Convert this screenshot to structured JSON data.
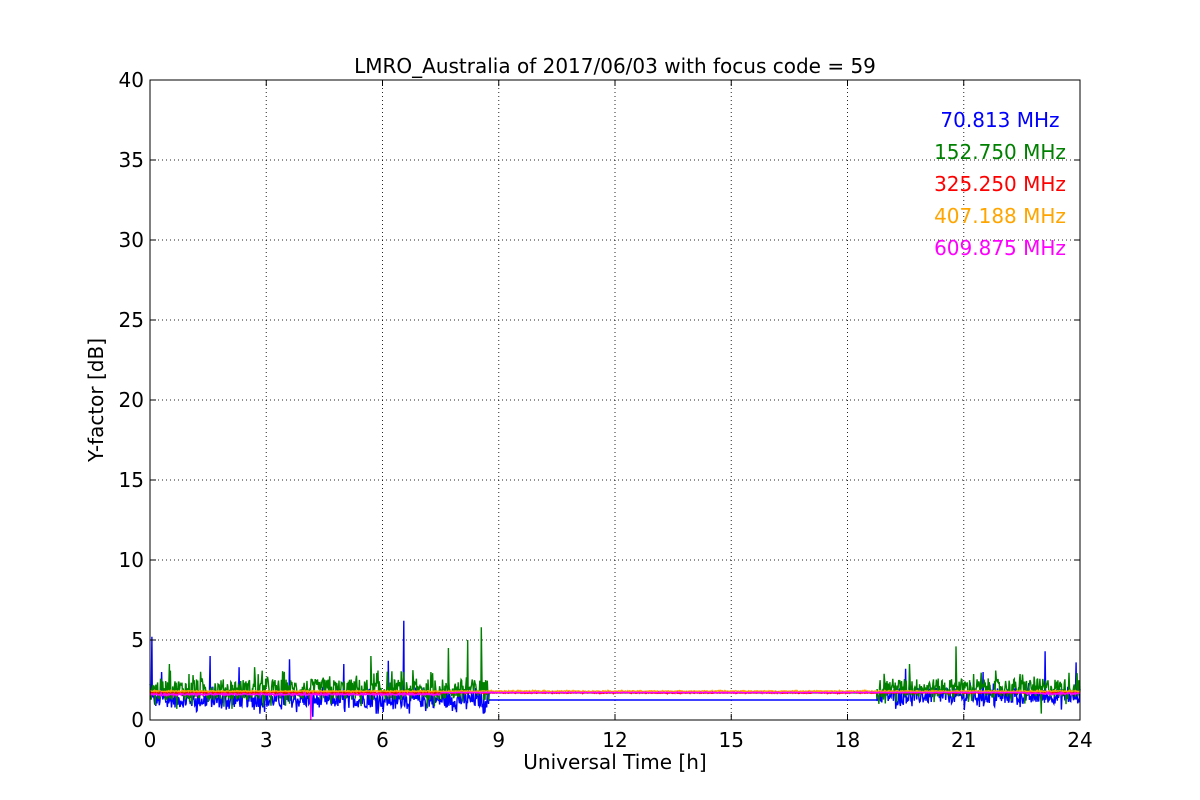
{
  "chart_data": {
    "type": "line",
    "title": "LMRO_Australia of 2017/06/03 with focus code = 59",
    "xlabel": "Universal Time [h]",
    "ylabel": "Y-factor [dB]",
    "xlim": [
      0,
      24
    ],
    "ylim": [
      0,
      40
    ],
    "xticks": [
      0,
      3,
      6,
      9,
      12,
      15,
      18,
      21,
      24
    ],
    "yticks": [
      0,
      5,
      10,
      15,
      20,
      25,
      30,
      35,
      40
    ],
    "grid": true,
    "legend_position": "top-right",
    "series": [
      {
        "name": "70.813 MHz",
        "color": "#0000ff",
        "segments": [
          {
            "x_range": [
              0,
              8.75
            ],
            "mean": 1.25,
            "noise": 0.8,
            "spikes": [
              [
                0.05,
                5.2
              ],
              [
                0.3,
                3.0
              ],
              [
                1.55,
                4.0
              ],
              [
                2.3,
                3.3
              ],
              [
                3.6,
                3.8
              ],
              [
                4.2,
                0.2
              ],
              [
                5.0,
                3.5
              ],
              [
                6.15,
                3.7
              ],
              [
                6.55,
                6.2
              ],
              [
                8.6,
                0.4
              ]
            ]
          },
          {
            "x_range": [
              8.75,
              18.75
            ],
            "mean": 1.25,
            "noise": 0,
            "spikes": []
          },
          {
            "x_range": [
              18.75,
              24
            ],
            "mean": 1.5,
            "noise": 0.8,
            "spikes": [
              [
                19.5,
                3.2
              ],
              [
                21.5,
                3.0
              ],
              [
                23.1,
                4.3
              ],
              [
                23.9,
                3.6
              ]
            ]
          }
        ]
      },
      {
        "name": "152.750 MHz",
        "color": "#008000",
        "segments": [
          {
            "x_range": [
              0,
              8.75
            ],
            "mean": 1.9,
            "noise": 1.1,
            "spikes": [
              [
                0.5,
                3.5
              ],
              [
                2.7,
                3.3
              ],
              [
                5.7,
                4.0
              ],
              [
                7.7,
                4.5
              ],
              [
                8.55,
                5.8
              ],
              [
                8.2,
                5.0
              ]
            ]
          },
          {
            "x_range": [
              8.75,
              18.75
            ],
            "mean": 1.7,
            "noise": 0,
            "spikes": []
          },
          {
            "x_range": [
              18.75,
              24
            ],
            "mean": 2.0,
            "noise": 1.0,
            "spikes": [
              [
                19.6,
                3.5
              ],
              [
                20.8,
                4.6
              ],
              [
                23.0,
                0.4
              ]
            ]
          }
        ]
      },
      {
        "name": "325.250 MHz",
        "color": "#ff0000",
        "segments": [
          {
            "x_range": [
              0,
              24
            ],
            "mean": 1.7,
            "noise": 0.05,
            "spikes": []
          }
        ]
      },
      {
        "name": "407.188 MHz",
        "color": "#ffa500",
        "segments": [
          {
            "x_range": [
              0,
              24
            ],
            "mean": 1.8,
            "noise": 0.05,
            "spikes": []
          }
        ]
      },
      {
        "name": "609.875 MHz",
        "color": "#ff00ff",
        "segments": [
          {
            "x_range": [
              0,
              7.5
            ],
            "mean": 1.6,
            "noise": 0.08,
            "spikes": [
              [
                4.15,
                0.0
              ]
            ]
          },
          {
            "x_range": [
              7.5,
              22.6
            ],
            "mean": 1.72,
            "noise": 0.03,
            "spikes": []
          },
          {
            "x_range": [
              22.6,
              24
            ],
            "mean": 1.65,
            "noise": 0.08,
            "spikes": []
          }
        ]
      }
    ]
  }
}
